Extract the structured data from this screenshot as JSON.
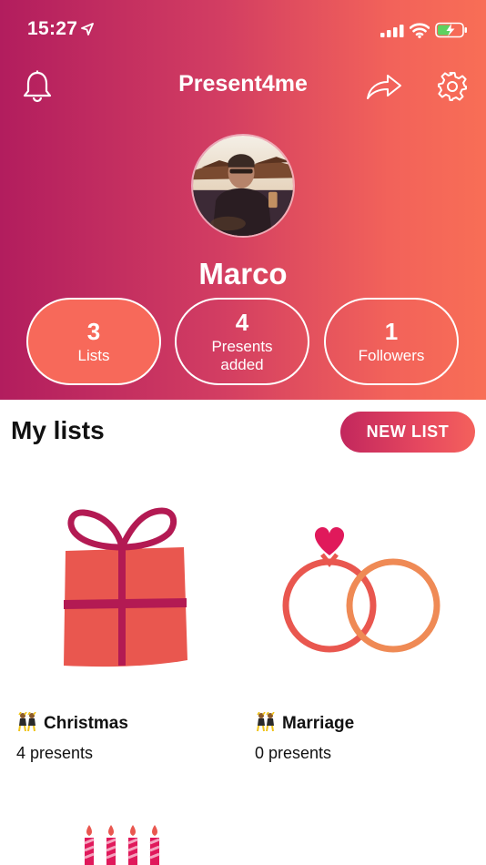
{
  "status_bar": {
    "time": "15:27"
  },
  "app": {
    "title": "Present4me"
  },
  "profile": {
    "name": "Marco"
  },
  "stats": [
    {
      "value": "3",
      "label": "Lists",
      "active": true
    },
    {
      "value": "4",
      "label": "Presents added",
      "active": false
    },
    {
      "value": "1",
      "label": "Followers",
      "active": false
    }
  ],
  "lists_section": {
    "title": "My lists",
    "new_button": "NEW LIST"
  },
  "lists": [
    {
      "icon": "gift-icon",
      "emoji": "dancers-emoji",
      "name": "Christmas",
      "count": "4 presents"
    },
    {
      "icon": "rings-icon",
      "emoji": "dancers-emoji",
      "name": "Marriage",
      "count": "0 presents"
    },
    {
      "icon": "birthday-candles-icon"
    }
  ],
  "colors": {
    "gradient_start": "#b21d5e",
    "gradient_end": "#f86e56",
    "accent": "#f7695a",
    "battery_charge": "#5ed160"
  }
}
